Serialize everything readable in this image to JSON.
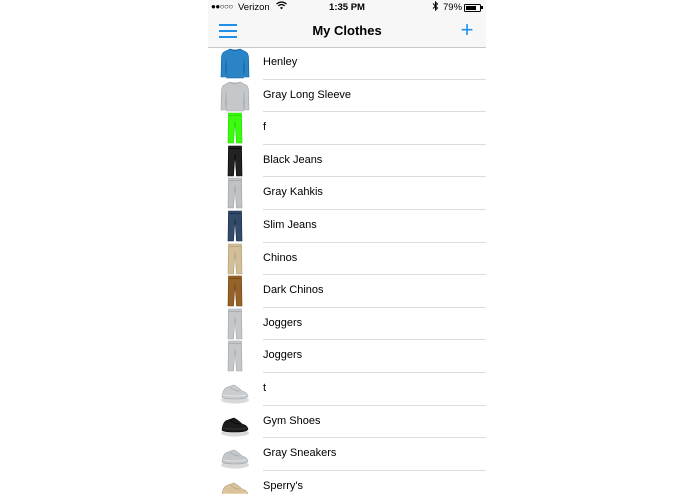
{
  "status": {
    "signal": "●●○○○",
    "carrier": "Verizon",
    "wifi_icon": "wifi-icon",
    "time": "1:35 PM",
    "bluetooth_icon": "bluetooth-icon",
    "battery_pct": "79%",
    "battery_level": 0.79
  },
  "nav": {
    "title": "My Clothes",
    "menu_icon": "hamburger-menu-icon",
    "add_icon": "plus-icon",
    "add_symbol": "+",
    "accent": "#1e90e8"
  },
  "items": [
    {
      "label": "Henley",
      "kind": "shirt",
      "color": "#2b84c6"
    },
    {
      "label": "Gray Long Sleeve",
      "kind": "shirt",
      "color": "#c4c8cb"
    },
    {
      "label": "f",
      "kind": "pants",
      "color": "#3dfb10"
    },
    {
      "label": "Black Jeans",
      "kind": "pants",
      "color": "#222222"
    },
    {
      "label": "Gray Kahkis",
      "kind": "pants",
      "color": "#bfc3c6"
    },
    {
      "label": "Slim Jeans",
      "kind": "pants",
      "color": "#344a69"
    },
    {
      "label": "Chinos",
      "kind": "pants",
      "color": "#d2bf98"
    },
    {
      "label": "Dark Chinos",
      "kind": "pants",
      "color": "#95622a"
    },
    {
      "label": "Joggers",
      "kind": "pants",
      "color": "#c4c8cb"
    },
    {
      "label": "Joggers",
      "kind": "pants",
      "color": "#c4c8cb"
    },
    {
      "label": "t",
      "kind": "shoes",
      "color": "#c9cdd0"
    },
    {
      "label": "Gym Shoes",
      "kind": "shoes",
      "color": "#1c1c1c"
    },
    {
      "label": "Gray Sneakers",
      "kind": "shoes",
      "color": "#c4c8cb"
    },
    {
      "label": "Sperry's",
      "kind": "shoes",
      "color": "#d8c39d"
    }
  ]
}
